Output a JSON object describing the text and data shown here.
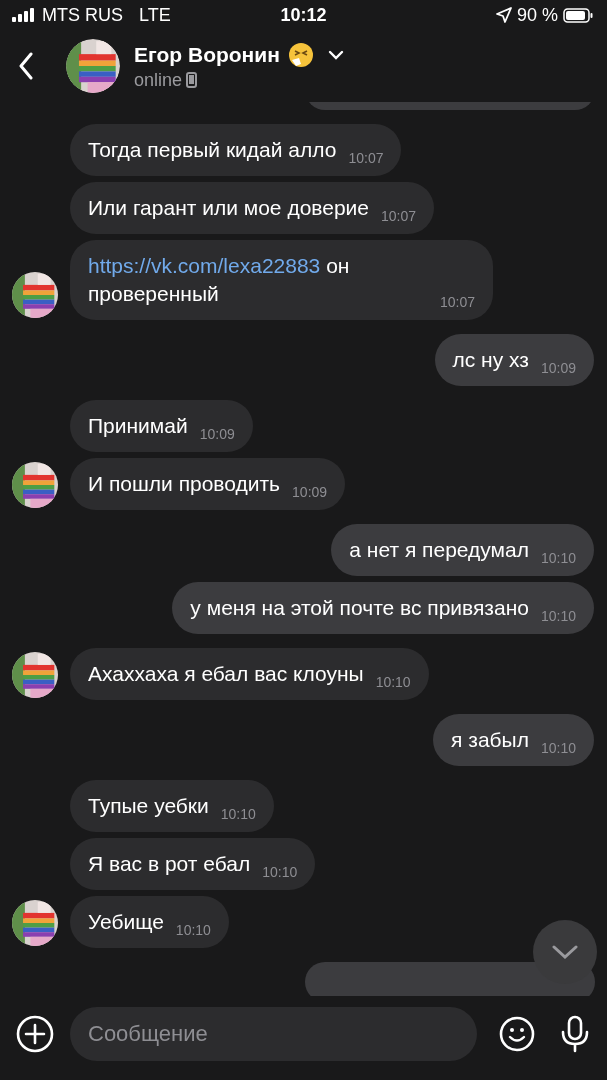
{
  "status_bar": {
    "carrier": "MTS RUS",
    "network": "LTE",
    "time": "10:12",
    "battery": "90 %"
  },
  "header": {
    "name": "Егор Воронин",
    "status": "online"
  },
  "cut_off_top": {
    "outgoing": true
  },
  "messages": [
    {
      "outgoing": false,
      "text": "Тогда первый кидай алло",
      "time": "10:07",
      "avatar": false
    },
    {
      "outgoing": false,
      "text": "Или гарант или мое доверие",
      "time": "10:07",
      "avatar": false
    },
    {
      "outgoing": false,
      "link": "https://vk.com/lexa22883",
      "text": " он проверенный",
      "time": "10:07",
      "avatar": true
    },
    {
      "outgoing": true,
      "text": "лс ну хз",
      "time": "10:09"
    },
    {
      "outgoing": false,
      "text": "Принимай",
      "time": "10:09",
      "avatar": false
    },
    {
      "outgoing": false,
      "text": "И пошли проводить",
      "time": "10:09",
      "avatar": true
    },
    {
      "outgoing": true,
      "text": "а нет я передумал",
      "time": "10:10"
    },
    {
      "outgoing": true,
      "text": "у меня на этой почте вс привязано",
      "time": "10:10"
    },
    {
      "outgoing": false,
      "text": "Ахаххаха я ебал вас клоуны",
      "time": "10:10",
      "avatar": true
    },
    {
      "outgoing": true,
      "text": "я забыл",
      "time": "10:10"
    },
    {
      "outgoing": false,
      "text": "Тупые уебки",
      "time": "10:10",
      "avatar": false
    },
    {
      "outgoing": false,
      "text": "Я вас в рот ебал",
      "time": "10:10",
      "avatar": false
    },
    {
      "outgoing": false,
      "text": "Уебище",
      "time": "10:10",
      "avatar": true
    }
  ],
  "cut_off_bottom": {
    "outgoing": true
  },
  "compose": {
    "placeholder": "Сообщение"
  }
}
